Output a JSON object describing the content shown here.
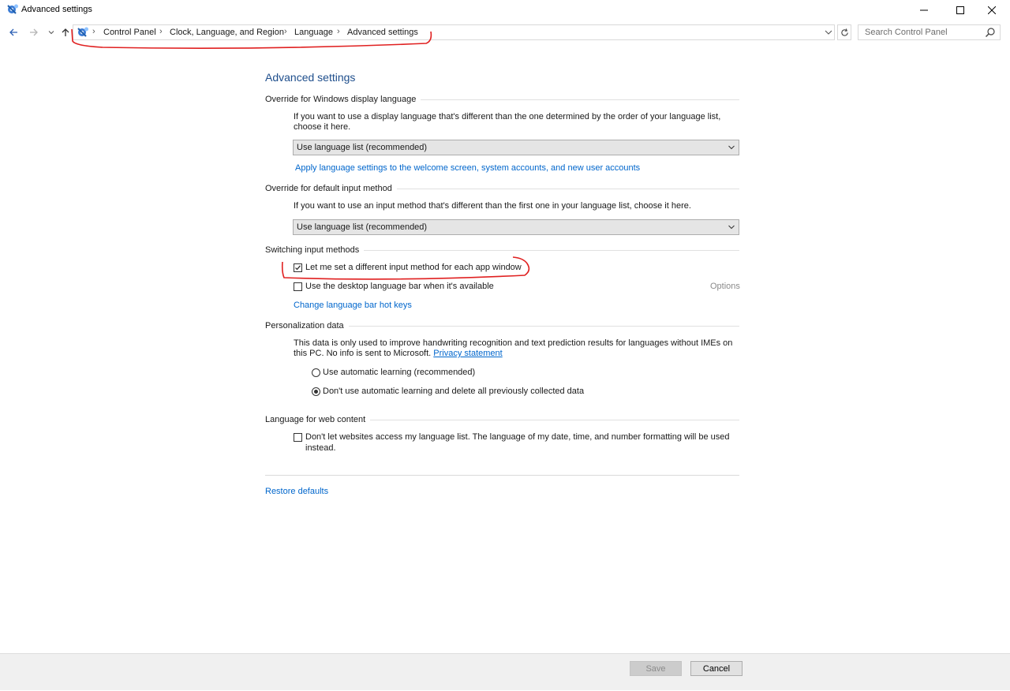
{
  "window": {
    "title": "Advanced settings",
    "minimize_icon": "minimize-icon",
    "maximize_icon": "maximize-icon",
    "close_icon": "close-icon"
  },
  "address_bar": {
    "breadcrumbs": [
      "Control Panel",
      "Clock, Language, and Region",
      "Language",
      "Advanced settings"
    ],
    "search_placeholder": "Search Control Panel"
  },
  "content": {
    "title": "Advanced settings",
    "display_language": {
      "heading": "Override for Windows display language",
      "description": "If you want to use a display language that's different than the one determined by the order of your language list, choose it here.",
      "selected": "Use language list (recommended)",
      "link": "Apply language settings to the welcome screen, system accounts, and new user accounts"
    },
    "input_method": {
      "heading": "Override for default input method",
      "description": "If you want to use an input method that's different than the first one in your language list, choose it here.",
      "selected": "Use language list (recommended)"
    },
    "switching": {
      "heading": "Switching input methods",
      "per_app_label": "Let me set a different input method for each app window",
      "per_app_checked": true,
      "desktop_bar_label": "Use the desktop language bar when it's available",
      "desktop_bar_checked": false,
      "options_label": "Options",
      "hotkeys_link": "Change language bar hot keys"
    },
    "personalization": {
      "heading": "Personalization data",
      "description_prefix": "This data is only used to improve handwriting recognition and text prediction results for languages without IMEs on this PC. No info is sent to Microsoft.",
      "privacy_link": "Privacy statement",
      "option_auto": "Use automatic learning (recommended)",
      "option_no_auto": "Don't use automatic learning and delete all previously collected data",
      "selected": "option_no_auto"
    },
    "web_content": {
      "heading": "Language for web content",
      "checkbox_label_line1": "Don't let websites access my language list. The language of my date, time, and number formatting will be used",
      "checkbox_label_line2": "instead.",
      "checked": false
    },
    "restore_link": "Restore defaults"
  },
  "footer": {
    "save_label": "Save",
    "cancel_label": "Cancel"
  },
  "colors": {
    "link": "#0066cc",
    "title": "#1e4e8c",
    "annotation": "#e02020"
  }
}
